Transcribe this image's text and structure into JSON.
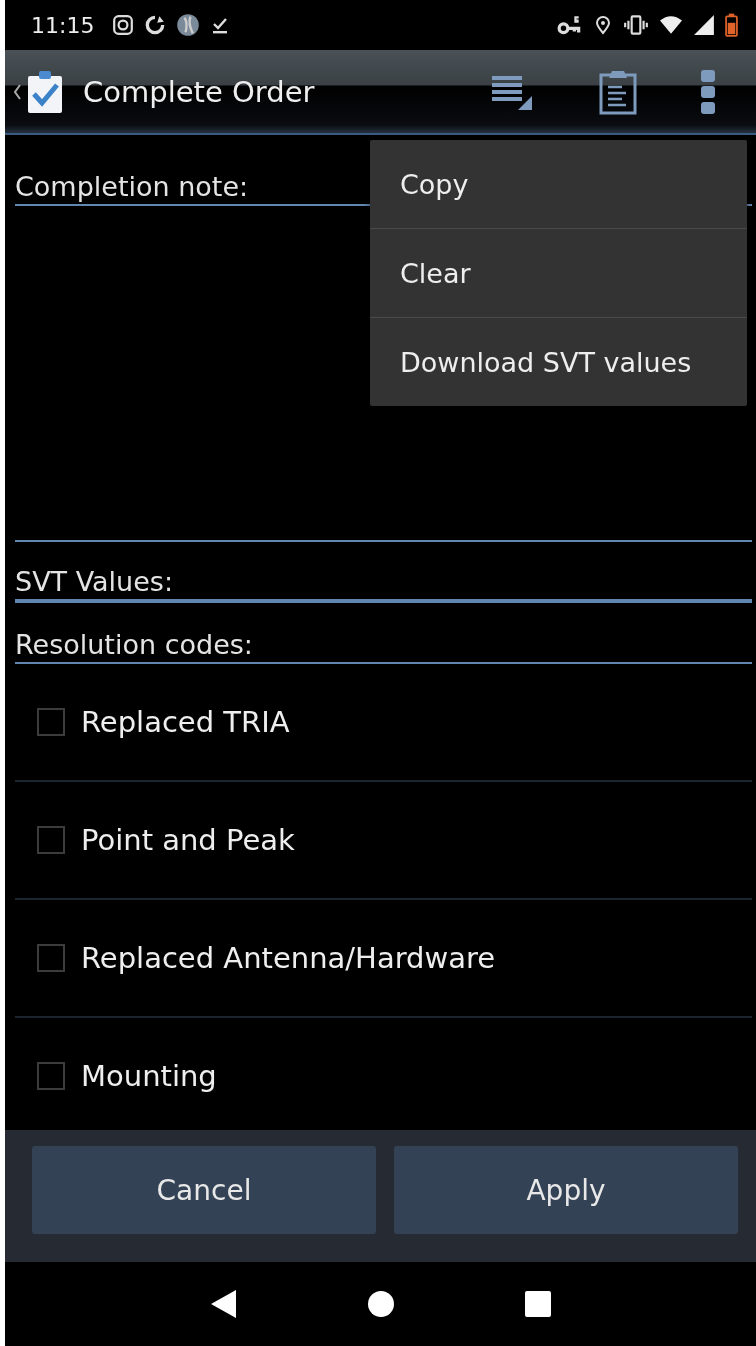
{
  "status_bar": {
    "time": "11:15"
  },
  "action_bar": {
    "title": "Complete Order"
  },
  "completion_note": {
    "label": "Completion note:"
  },
  "svt_values": {
    "label": "SVT Values:"
  },
  "resolution_codes": {
    "label": "Resolution codes:",
    "items": [
      {
        "label": "Replaced TRIA",
        "checked": false
      },
      {
        "label": "Point and Peak",
        "checked": false
      },
      {
        "label": "Replaced Antenna/Hardware",
        "checked": false
      },
      {
        "label": "Mounting",
        "checked": false
      }
    ]
  },
  "buttons": [
    {
      "label": "Cancel"
    },
    {
      "label": "Apply"
    }
  ],
  "menu": {
    "items": [
      {
        "label": "Copy"
      },
      {
        "label": "Clear"
      },
      {
        "label": "Download SVT values"
      }
    ]
  }
}
